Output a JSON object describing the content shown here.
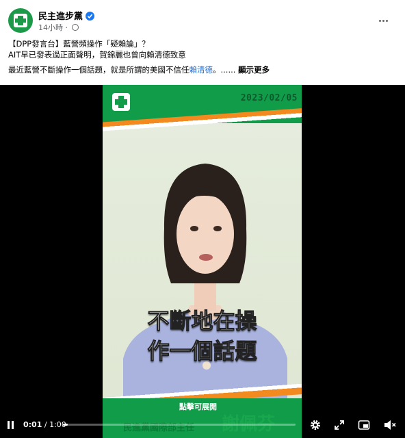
{
  "post": {
    "page_name": "民主進步黨",
    "time_ago": "14小時",
    "separator": "·",
    "verified_icon": "verified-badge-icon",
    "privacy_icon": "globe-icon",
    "more_icon": "more-options-icon"
  },
  "text": {
    "line1": "【DPP發言台】藍營頻操作「疑賴論」？",
    "line2": "AIT早已發表過正面聲明，賀錦麗也曾向賴清德致意",
    "line3_prefix": "最近藍營不斷操作一個話題，就是所謂的美國不信任",
    "line3_link": "賴清德",
    "line3_suffix": "。...... ",
    "see_more": "顯示更多"
  },
  "video": {
    "date": "2023/02/05",
    "caption_line1": "不斷地在操",
    "caption_line2": "作一個話題",
    "expand_label": "點擊可展開",
    "speaker_role": "民進黨國際部主任",
    "speaker_name": "謝佩芬",
    "current_time": "0:01",
    "time_separator": " / ",
    "duration": "1:00",
    "progress": 0.02,
    "controls": {
      "play_icon": "pause-icon",
      "settings_icon": "gear-icon",
      "fullscreen_expand_icon": "expand-icon",
      "fullscreen_icon": "fullscreen-icon",
      "pip_icon": "picture-in-picture-icon",
      "mute_icon": "volume-muted-icon"
    }
  },
  "colors": {
    "dpp_green": "#119c4a",
    "accent_orange": "#f38a1f",
    "link_blue": "#216fdb",
    "verified_blue": "#1877f2"
  }
}
